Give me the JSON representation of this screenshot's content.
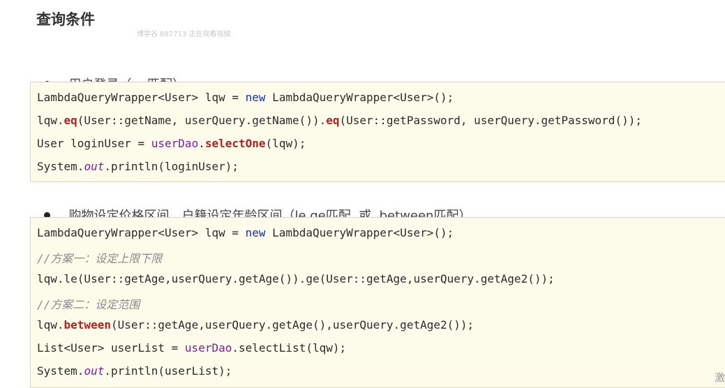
{
  "page": {
    "title": "查询条件",
    "watermark": "博学谷 887713 正在观看视频",
    "corner_glyph": "激"
  },
  "sections": [
    {
      "bullet": "用户登录（eq匹配）"
    },
    {
      "bullet": "购物设定价格区间、户籍设定年龄区间（le ge匹配  或  between匹配）"
    }
  ],
  "code1": [
    [
      [
        "",
        "LambdaQueryWrapper<User> lqw = "
      ],
      [
        "kw",
        "new"
      ],
      [
        "",
        " LambdaQueryWrapper<User>();"
      ]
    ],
    [
      [
        "",
        "lqw."
      ],
      [
        "m",
        "eq"
      ],
      [
        "",
        "(User::getName, userQuery.getName())."
      ],
      [
        "m",
        "eq"
      ],
      [
        "",
        "(User::getPassword, userQuery.getPassword());"
      ]
    ],
    [
      [
        "",
        "User loginUser = "
      ],
      [
        "f",
        "userDao"
      ],
      [
        "",
        "."
      ],
      [
        "m",
        "selectOne"
      ],
      [
        "",
        "(lqw);"
      ]
    ],
    [
      [
        "",
        "System."
      ],
      [
        "s",
        "out"
      ],
      [
        "",
        ".println(loginUser);"
      ]
    ]
  ],
  "code2": [
    [
      [
        "",
        "LambdaQueryWrapper<User> lqw = "
      ],
      [
        "kw",
        "new"
      ],
      [
        "",
        " LambdaQueryWrapper<User>();"
      ]
    ],
    [
      [
        "cm",
        "//方案一：设定上限下限"
      ]
    ],
    [
      [
        "",
        "lqw.le(User::getAge,userQuery.getAge()).ge(User::getAge,userQuery.getAge2());"
      ]
    ],
    [
      [
        "cm",
        "//方案二：设定范围"
      ]
    ],
    [
      [
        "",
        "lqw."
      ],
      [
        "m",
        "between"
      ],
      [
        "",
        "(User::getAge,userQuery.getAge(),userQuery.getAge2());"
      ]
    ],
    [
      [
        "",
        "List<User> userList = "
      ],
      [
        "f",
        "userDao"
      ],
      [
        "",
        ".selectList(lqw);"
      ]
    ],
    [
      [
        "",
        "System."
      ],
      [
        "s",
        "out"
      ],
      [
        "",
        ".println(userList);"
      ]
    ]
  ]
}
